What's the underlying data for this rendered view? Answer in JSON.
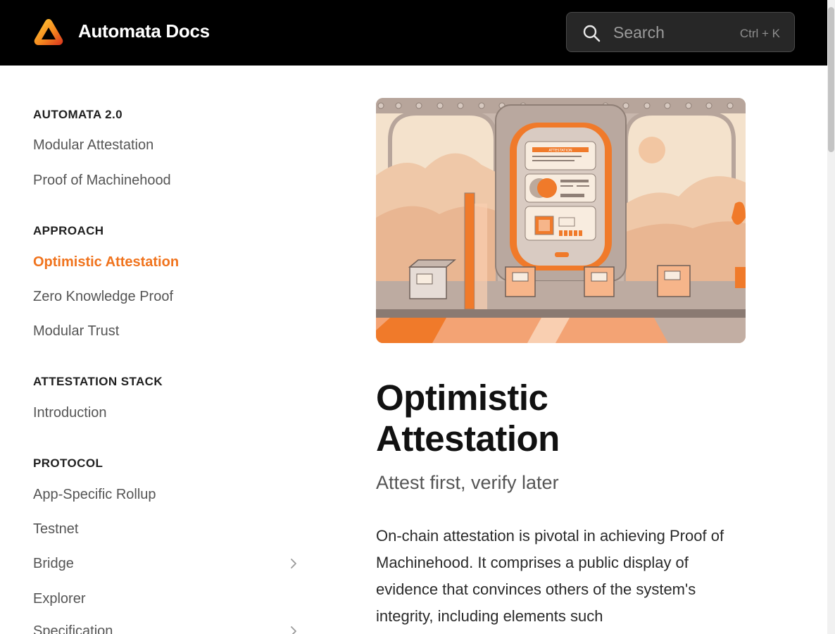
{
  "header": {
    "title": "Automata Docs",
    "search_placeholder": "Search",
    "search_shortcut": "Ctrl + K",
    "logo_icon": "automata-triangle-logo"
  },
  "sidebar": {
    "sections": [
      {
        "title": "AUTOMATA 2.0",
        "items": [
          "Modular Attestation",
          "Proof of Machinehood"
        ]
      },
      {
        "title": "APPROACH",
        "items": [
          "Optimistic Attestation",
          "Zero Knowledge Proof",
          "Modular Trust"
        ]
      },
      {
        "title": "ATTESTATION STACK",
        "items": [
          "Introduction"
        ]
      },
      {
        "title": "PROTOCOL",
        "items": [
          "App-Specific Rollup",
          "Testnet",
          "Bridge",
          "Explorer",
          "Specification"
        ]
      }
    ],
    "active_item": "Optimistic Attestation"
  },
  "hero": {
    "caption_text": "ATTESTATION"
  },
  "article": {
    "title": "Optimistic Attestation",
    "subtitle": "Attest first, verify later",
    "body": "On-chain attestation is pivotal in achieving Proof of Machinehood. It comprises a public display of evidence that convinces others of the system's integrity, including elements such"
  },
  "colors": {
    "accent": "#f0731d",
    "header_bg": "#000000",
    "search_bg": "#272727"
  }
}
